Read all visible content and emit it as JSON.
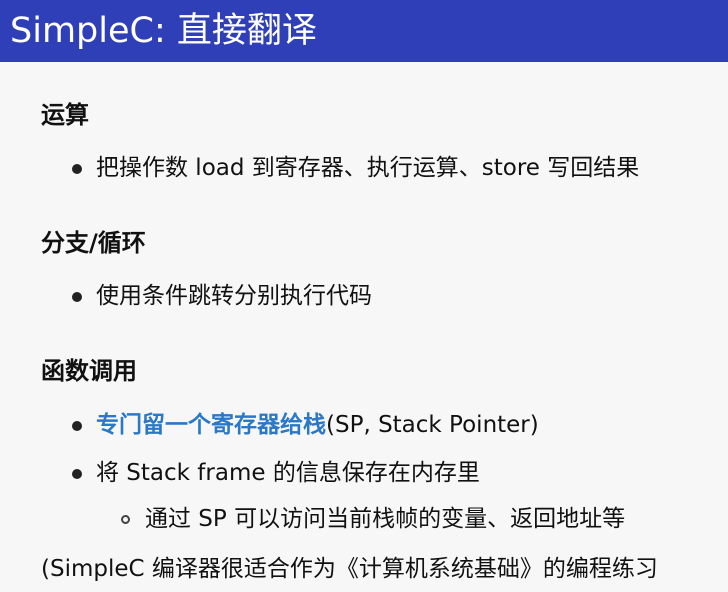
{
  "slide": {
    "title": "SimpleC: 直接翻译"
  },
  "sections": [
    {
      "heading": "运算",
      "bullets": [
        {
          "text": "把操作数 load 到寄存器、执行运算、store 写回结果"
        }
      ]
    },
    {
      "heading": "分支/循环",
      "bullets": [
        {
          "text": "使用条件跳转分别执行代码"
        }
      ]
    },
    {
      "heading": "函数调用",
      "bullets": [
        {
          "emphasis": "专门留一个寄存器给栈",
          "text": " (SP, Stack Pointer)"
        },
        {
          "text": "将 Stack frame 的信息保存在内存里",
          "subbullets": [
            {
              "text": "通过 SP 可以访问当前栈帧的变量、返回地址等"
            }
          ]
        }
      ]
    }
  ],
  "footer": {
    "note": "(SimpleC 编译器很适合作为《计算机系统基础》的编程练习"
  },
  "colors": {
    "title_bar": "#2f3fb8",
    "title_text": "#ffffff",
    "emphasis": "#2b78c8",
    "body_text": "#111111",
    "background": "#f7f7f7"
  }
}
